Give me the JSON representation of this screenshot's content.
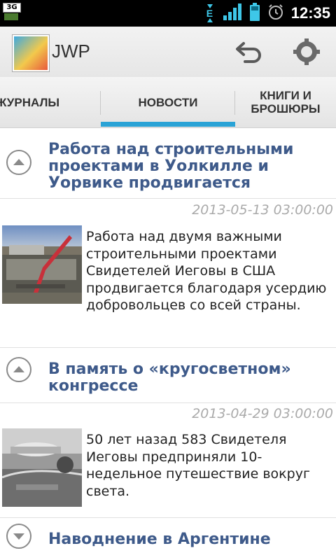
{
  "status_bar": {
    "network_badge": "3G",
    "data_indicator": "E",
    "time": "12:35"
  },
  "app": {
    "title": "JWP"
  },
  "tabs": [
    {
      "label": "ЖУРНАЛЫ",
      "selected": false
    },
    {
      "label": "НОВОСТИ",
      "selected": true
    },
    {
      "label": "КНИГИ И БРОШЮРЫ",
      "selected": false
    }
  ],
  "colors": {
    "accent": "#2aa3d6",
    "title_text": "#3e5a8a",
    "date_text": "#aaaaaa"
  },
  "news": [
    {
      "title": "Работа над строительными проектами в Уолкилле и Уорвике продвигается",
      "date": "2013-05-13 03:00:00",
      "summary": "Работа над двумя важными строительными проектами Свидетелей Иеговы в США продвигается благодаря усердию добровольцев со всей страны.",
      "expanded": true
    },
    {
      "title": "В память о «кругосветном» конгрессе",
      "date": "2013-04-29 03:00:00",
      "summary": "50 лет назад 583 Свидетеля Иеговы предприняли 10-недельное путешествие вокруг света.",
      "expanded": true
    },
    {
      "title": "Наводнение в Аргентине",
      "expanded": false
    }
  ]
}
